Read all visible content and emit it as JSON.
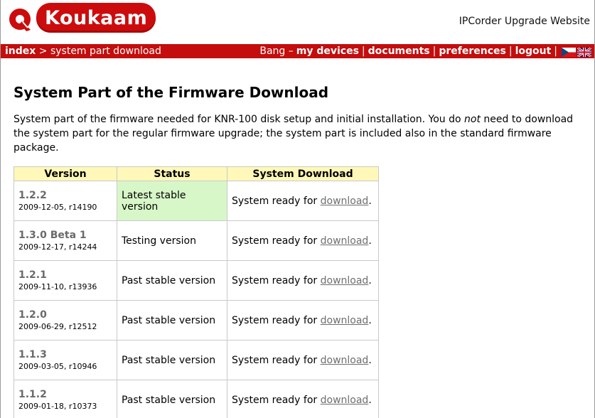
{
  "header": {
    "brand": "Koukaam",
    "site_title": "IPCorder Upgrade Website"
  },
  "nav": {
    "breadcrumb_index": "index",
    "breadcrumb_separator": ">",
    "breadcrumb_current": "system part download",
    "user": "Bang –",
    "links": {
      "my_devices": "my devices",
      "documents": "documents",
      "preferences": "preferences",
      "logout": "logout"
    },
    "separator": "|",
    "flags": [
      "czech-flag-icon",
      "uk-flag-icon"
    ]
  },
  "main": {
    "title": "System Part of the Firmware Download",
    "intro_part1": "System part of the firmware needed for KNR-100 disk setup and initial installation. You do ",
    "intro_em": "not",
    "intro_part2": " need to download the system part for the regular firmware upgrade; the system part is included also in the standard firmware package."
  },
  "table": {
    "headers": {
      "version": "Version",
      "status": "Status",
      "download": "System Download"
    },
    "download_prefix": "System ready for ",
    "download_link": "download",
    "download_suffix": ".",
    "rows": [
      {
        "version": "1.2.2",
        "date": "2009-12-05, r14190",
        "status": "Latest stable version"
      },
      {
        "version": "1.3.0 Beta 1",
        "date": "2009-12-17, r14244",
        "status": "Testing version"
      },
      {
        "version": "1.2.1",
        "date": "2009-11-10, r13936",
        "status": "Past stable version"
      },
      {
        "version": "1.2.0",
        "date": "2009-06-29, r12512",
        "status": "Past stable version"
      },
      {
        "version": "1.1.3",
        "date": "2009-03-05, r10946",
        "status": "Past stable version"
      },
      {
        "version": "1.1.2",
        "date": "2009-01-18, r10373",
        "status": "Past stable version"
      }
    ]
  },
  "colors": {
    "brand_red": "#c40d0d",
    "header_yellow": "#fff8b8",
    "latest_green": "#d8f7c8",
    "link_gray": "#6e6e6e"
  }
}
